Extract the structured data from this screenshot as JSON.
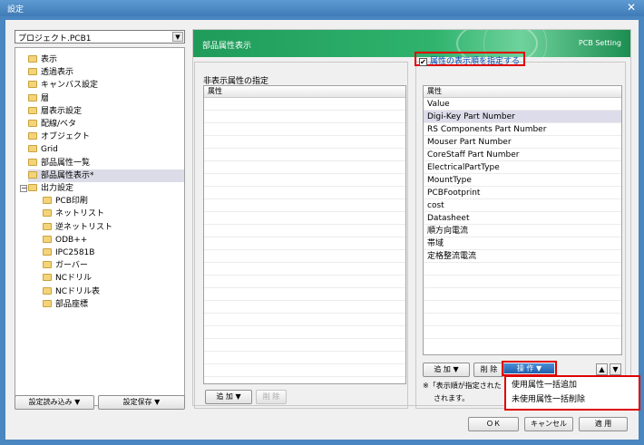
{
  "window": {
    "title": "設定",
    "close": "✕"
  },
  "project_combo": {
    "value": "プロジェクト.PCB1",
    "arrow": "▼"
  },
  "tree": {
    "items": [
      {
        "label": "表示",
        "indent": 0
      },
      {
        "label": "透過表示",
        "indent": 0
      },
      {
        "label": "キャンバス設定",
        "indent": 0
      },
      {
        "label": "層",
        "indent": 0
      },
      {
        "label": "層表示設定",
        "indent": 0
      },
      {
        "label": "配線/ベタ",
        "indent": 0
      },
      {
        "label": "オブジェクト",
        "indent": 0
      },
      {
        "label": "Grid",
        "indent": 0
      },
      {
        "label": "部品属性一覧",
        "indent": 0
      },
      {
        "label": "部品属性表示*",
        "indent": 0,
        "selected": true
      },
      {
        "label": "出力設定",
        "indent": 0,
        "expander": "−"
      },
      {
        "label": "PCB印刷",
        "indent": 1
      },
      {
        "label": "ネットリスト",
        "indent": 1
      },
      {
        "label": "逆ネットリスト",
        "indent": 1
      },
      {
        "label": "ODB++",
        "indent": 1
      },
      {
        "label": "IPC2581B",
        "indent": 1
      },
      {
        "label": "ガーバー",
        "indent": 1
      },
      {
        "label": "NCドリル",
        "indent": 1
      },
      {
        "label": "NCドリル表",
        "indent": 1
      },
      {
        "label": "部品座標",
        "indent": 1
      }
    ]
  },
  "bottom_left": {
    "load": "設定読み込み ▼",
    "save": "設定保存 ▼"
  },
  "banner": {
    "heading": "部品属性表示",
    "subtitle": "PCB Setting"
  },
  "hidden_panel": {
    "label": "非表示属性の指定",
    "column": "属性",
    "add": "追 加 ▼",
    "delete": "削 除"
  },
  "shown_panel": {
    "checkbox_label": "属性の表示順を指定する",
    "checked": true,
    "column": "属性",
    "rows": [
      "Value",
      "Digi-Key Part Number",
      "RS Components Part Number",
      "Mouser Part Number",
      "CoreStaff Part Number",
      "ElectricalPartType",
      "MountType",
      "PCBFootprint",
      "cost",
      "Datasheet",
      "順方向電流",
      "帯域",
      "定格整流電流"
    ],
    "selected_index": 1,
    "add": "追 加 ▼",
    "delete": "削 除",
    "operate": "操 作 ▼",
    "up": "▲",
    "down": "▼",
    "note_line1": "※「表示順が指定された",
    "note_line2": "されます。"
  },
  "popup": {
    "items": [
      "使用属性一括追加",
      "未使用属性一括削除"
    ]
  },
  "footer": {
    "ok": "ＯＫ",
    "cancel": "キャンセル",
    "apply": "適 用"
  },
  "colors": {
    "highlight_red": "#e00000",
    "banner_green": "#2fb36d",
    "link_blue": "#0047b3"
  }
}
